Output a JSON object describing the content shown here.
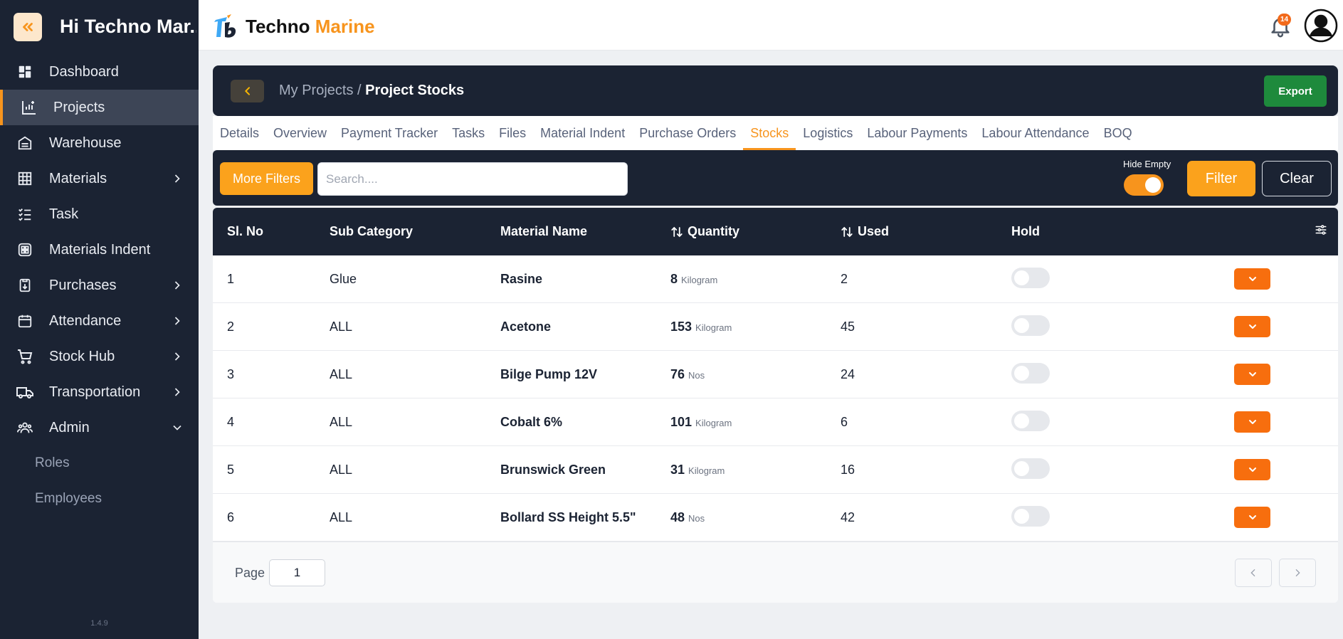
{
  "sidebar": {
    "greeting": "Hi Techno Mar...",
    "version": "1.4.9",
    "items": [
      {
        "label": "Dashboard",
        "icon": "dashboard-icon"
      },
      {
        "label": "Projects",
        "icon": "projects-chart-icon",
        "active": true
      },
      {
        "label": "Warehouse",
        "icon": "warehouse-icon"
      },
      {
        "label": "Materials",
        "icon": "grid-icon",
        "expandable": true
      },
      {
        "label": "Task",
        "icon": "checklist-icon"
      },
      {
        "label": "Materials Indent",
        "icon": "indent-icon"
      },
      {
        "label": "Purchases",
        "icon": "purchases-icon",
        "expandable": true
      },
      {
        "label": "Attendance",
        "icon": "calendar-icon",
        "expandable": true
      },
      {
        "label": "Stock Hub",
        "icon": "cart-icon",
        "expandable": true
      },
      {
        "label": "Transportation",
        "icon": "truck-icon",
        "expandable": true
      },
      {
        "label": "Admin",
        "icon": "users-icon",
        "expanded": true
      }
    ],
    "admin_sub": [
      {
        "label": "Roles"
      },
      {
        "label": "Employees"
      }
    ]
  },
  "topbar": {
    "brand_first": "Techno",
    "brand_second": "Marine",
    "notification_count": "14"
  },
  "header": {
    "breadcrumb_parent": "My Projects /",
    "breadcrumb_current": "Project Stocks",
    "export_label": "Export"
  },
  "tabs": [
    {
      "label": "Details"
    },
    {
      "label": "Overview"
    },
    {
      "label": "Payment Tracker"
    },
    {
      "label": "Tasks"
    },
    {
      "label": "Files"
    },
    {
      "label": "Material Indent"
    },
    {
      "label": "Purchase Orders"
    },
    {
      "label": "Stocks",
      "active": true
    },
    {
      "label": "Logistics"
    },
    {
      "label": "Labour Payments"
    },
    {
      "label": "Labour Attendance"
    },
    {
      "label": "BOQ"
    }
  ],
  "filters": {
    "more_filters_label": "More Filters",
    "search_placeholder": "Search....",
    "hide_empty_label": "Hide Empty",
    "hide_empty_on": true,
    "filter_label": "Filter",
    "clear_label": "Clear"
  },
  "table": {
    "headers": {
      "sl_no": "Sl. No",
      "sub_category": "Sub Category",
      "material_name": "Material Name",
      "quantity": "Quantity",
      "used": "Used",
      "hold": "Hold"
    },
    "rows": [
      {
        "sl": "1",
        "sub": "Glue",
        "name": "Rasine",
        "qty": "8",
        "unit": "Kilogram",
        "used": "2"
      },
      {
        "sl": "2",
        "sub": "ALL",
        "name": "Acetone",
        "qty": "153",
        "unit": "Kilogram",
        "used": "45"
      },
      {
        "sl": "3",
        "sub": "ALL",
        "name": "Bilge Pump 12V",
        "qty": "76",
        "unit": "Nos",
        "used": "24"
      },
      {
        "sl": "4",
        "sub": "ALL",
        "name": "Cobalt 6%",
        "qty": "101",
        "unit": "Kilogram",
        "used": "6"
      },
      {
        "sl": "5",
        "sub": "ALL",
        "name": "Brunswick Green",
        "qty": "31",
        "unit": "Kilogram",
        "used": "16"
      },
      {
        "sl": "6",
        "sub": "ALL",
        "name": "Bollard SS Height 5.5\"",
        "qty": "48",
        "unit": "Nos",
        "used": "42"
      }
    ]
  },
  "pagination": {
    "page_label": "Page",
    "page_value": "1"
  },
  "colors": {
    "sidebar_bg": "#1b2333",
    "accent": "#f7941d",
    "export_green": "#1e8a3c",
    "action_orange": "#f76e0e"
  }
}
